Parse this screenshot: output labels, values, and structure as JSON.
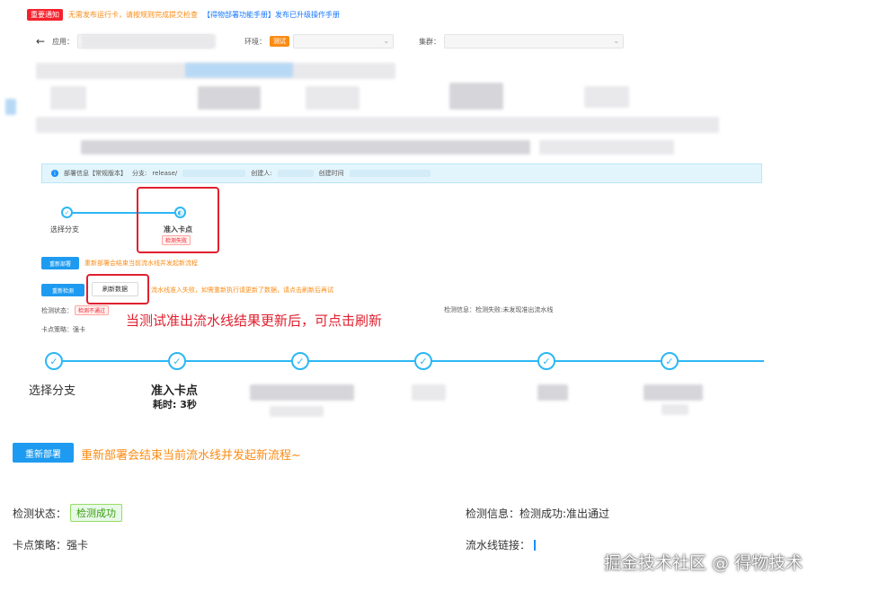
{
  "notice": {
    "tag": "重要通知",
    "text_orange": "无需发布运行卡，请按规则完成提交检查",
    "text_blue": "【得物部署功能手册】发布已升级操作手册"
  },
  "filters": {
    "back_icon": "arrow-left-icon",
    "app_label": "应用：",
    "env_label": "环境：",
    "env_badge": "测试",
    "cluster_label": "集群："
  },
  "infobar": {
    "icon": "info-icon",
    "title": "部署信息【常规版本】",
    "branch_label": "分支:",
    "branch_value": "release/",
    "creator_label": "创建人:",
    "created_label": "创建时间"
  },
  "small_steps": {
    "step1": "选择分支",
    "step2": "准入卡点",
    "step2_badge": "检测失败"
  },
  "small_buttons": {
    "deploy_btn": "重新部署",
    "deploy_note": "重新部署会结束当前流水线并发起新流程",
    "retry_btn": "重新检测",
    "refresh_btn": "刷新数据",
    "refresh_note": "流水线准入失败，如需重新执行请更新了数据，请点击刷新后再试"
  },
  "small_fields": {
    "status_label": "检测状态：",
    "status_value": "检测不通过",
    "info_label": "检测信息：",
    "info_value": "检测失败:未发现准出流水线",
    "strategy_label": "卡点策略：",
    "strategy_value": "强卡"
  },
  "annotation": "当测试准出流水线结果更新后，可点击刷新",
  "big_steps": {
    "step1": "选择分支",
    "step2": "准入卡点",
    "step2_time": "耗时: 3秒"
  },
  "redeploy": {
    "button": "重新部署",
    "note": "重新部署会结束当前流水线并发起新流程~"
  },
  "fields": {
    "status_label": "检测状态：",
    "status_value": "检测成功",
    "info_label": "检测信息：",
    "info_value": "检测成功:准出通过",
    "strategy_label": "卡点策略：",
    "strategy_value": "强卡",
    "pipeline_label": "流水线链接："
  },
  "watermark": "掘金技术社区 @ 得物技术",
  "colors": {
    "primary": "#1e9bf0",
    "step_line": "#2db7f5",
    "annotation_red": "#e0202f",
    "warning_orange": "#fa8c16",
    "success_green": "#389e0d"
  }
}
